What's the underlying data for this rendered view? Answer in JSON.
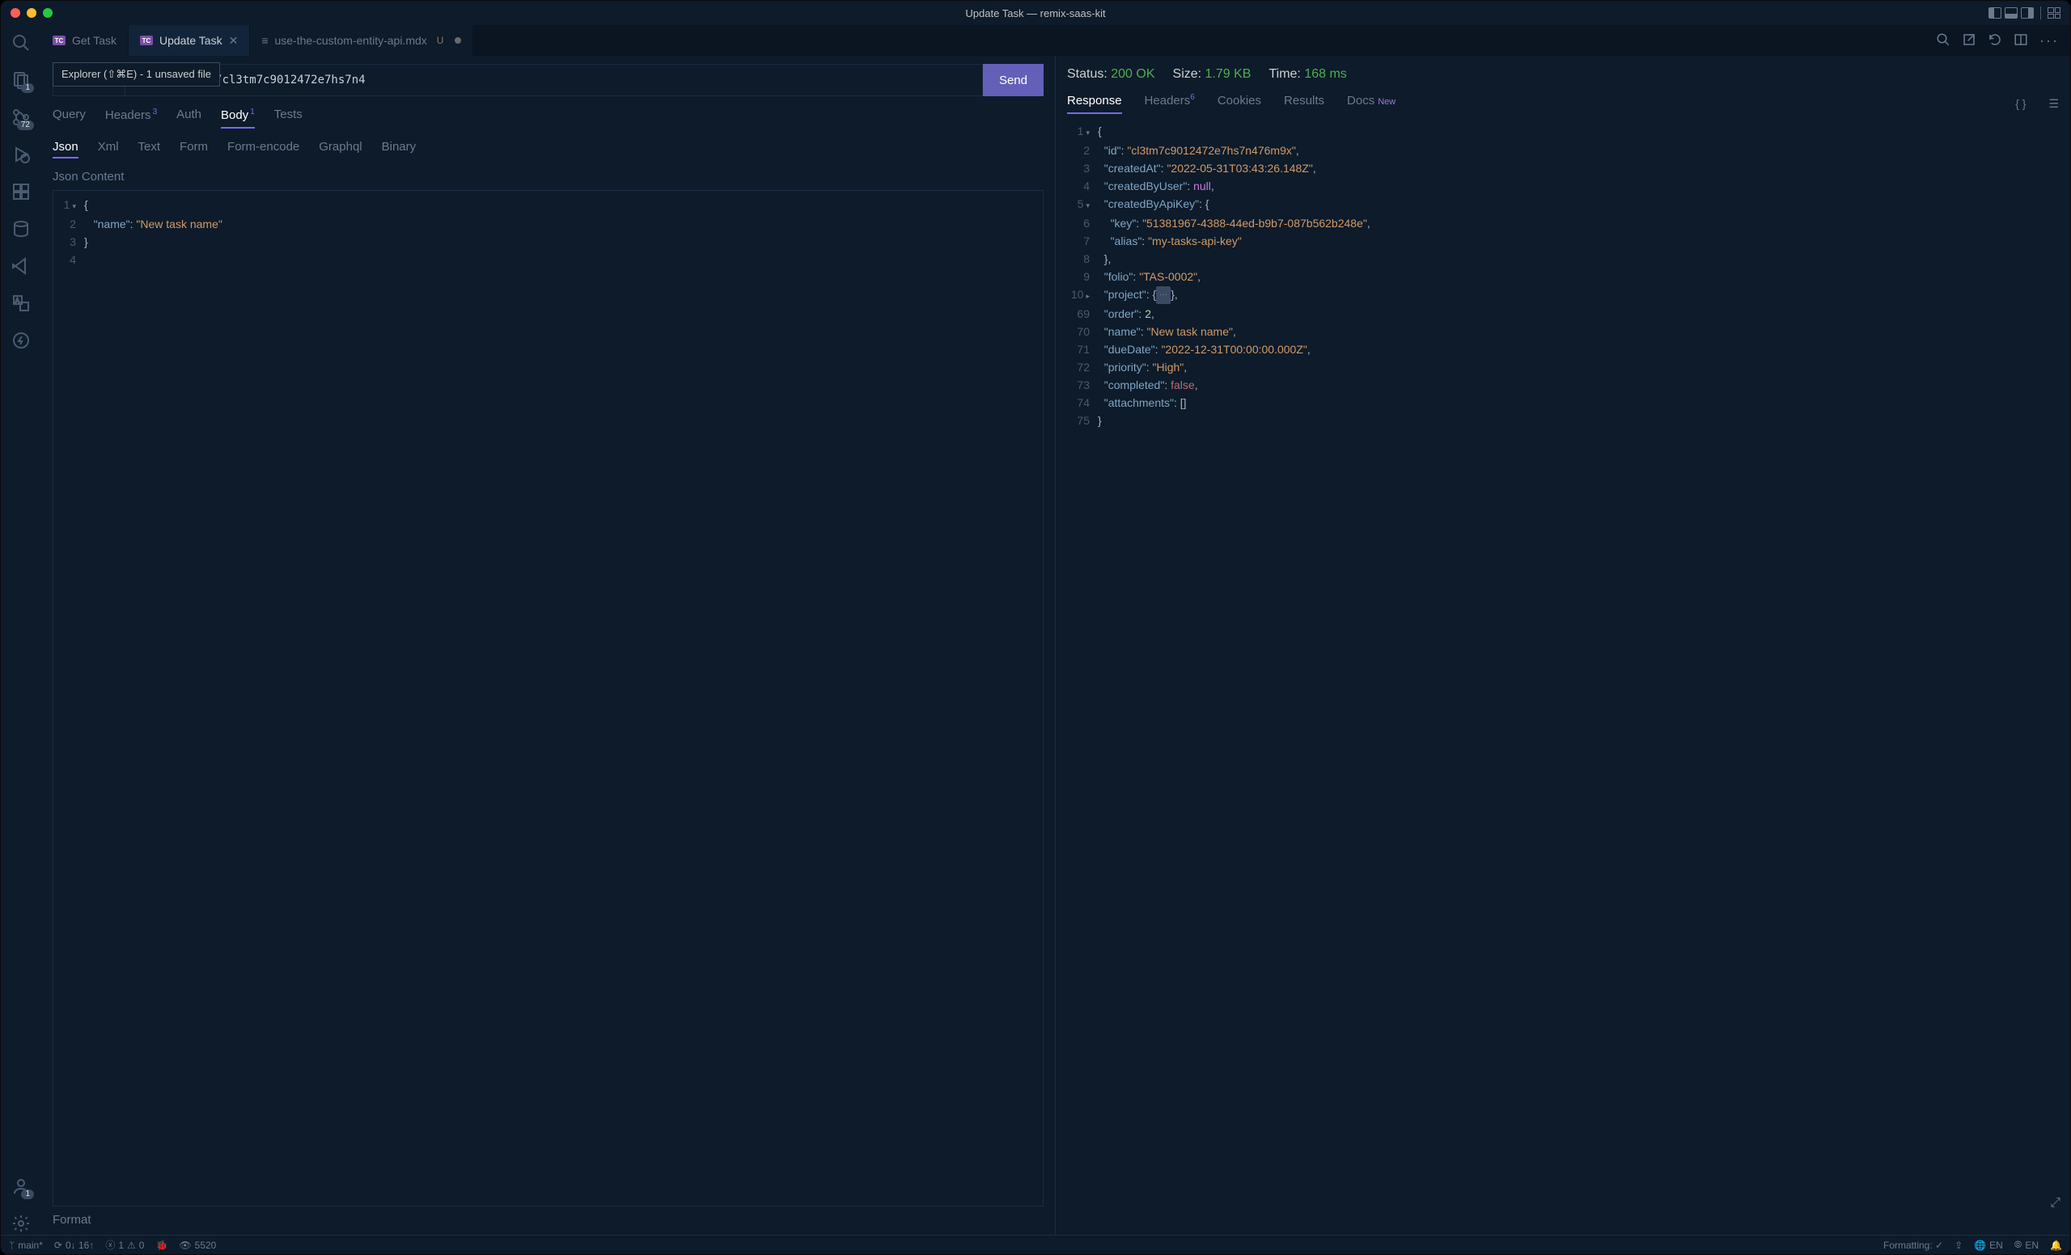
{
  "window_title": "Update Task — remix-saas-kit",
  "tabs": [
    {
      "icon": "TC",
      "label": "Get Task",
      "active": false,
      "closable": false
    },
    {
      "icon": "TC",
      "label": "Update Task",
      "active": true,
      "closable": true
    },
    {
      "icon": "list",
      "label": "use-the-custom-entity-api.mdx",
      "active": false,
      "badge": "U",
      "dot": true
    }
  ],
  "tooltip": "Explorer (⇧⌘E) - 1 unsaved file",
  "activity_badges": {
    "explorer": "1",
    "scm": "72",
    "account": "1"
  },
  "url_bar": {
    "url_visible": ")0/api/tasks/cl3tm7c9012472e7hs7n4",
    "send": "Send"
  },
  "request_tabs": [
    {
      "label": "Query"
    },
    {
      "label": "Headers",
      "badge": "3"
    },
    {
      "label": "Auth"
    },
    {
      "label": "Body",
      "badge": "1",
      "active": true
    },
    {
      "label": "Tests"
    }
  ],
  "body_type_tabs": [
    {
      "label": "Json",
      "active": true
    },
    {
      "label": "Xml"
    },
    {
      "label": "Text"
    },
    {
      "label": "Form"
    },
    {
      "label": "Form-encode"
    },
    {
      "label": "Graphql"
    },
    {
      "label": "Binary"
    }
  ],
  "json_content_label": "Json Content",
  "request_body_lines": [
    {
      "n": "1",
      "fold": true,
      "tokens": [
        [
          "punc",
          "{"
        ]
      ]
    },
    {
      "n": "2",
      "tokens": [
        [
          "",
          "   "
        ],
        [
          "key",
          "\"name\""
        ],
        [
          "punc",
          ": "
        ],
        [
          "str",
          "\"New task name\""
        ]
      ]
    },
    {
      "n": "3",
      "tokens": [
        [
          "punc",
          "}"
        ]
      ]
    },
    {
      "n": "4",
      "tokens": []
    }
  ],
  "format_label": "Format",
  "status": {
    "status_label": "Status: ",
    "status_val": "200 OK",
    "size_label": "Size: ",
    "size_val": "1.79 KB",
    "time_label": "Time: ",
    "time_val": "168 ms"
  },
  "response_tabs": [
    {
      "label": "Response",
      "active": true
    },
    {
      "label": "Headers",
      "badge": "6"
    },
    {
      "label": "Cookies"
    },
    {
      "label": "Results"
    },
    {
      "label": "Docs",
      "new": "New"
    }
  ],
  "response_lines": [
    {
      "n": "1",
      "fold": "down",
      "tokens": [
        [
          "punc",
          "{"
        ]
      ]
    },
    {
      "n": "2",
      "tokens": [
        [
          "",
          "  "
        ],
        [
          "key",
          "\"id\""
        ],
        [
          "punc",
          ": "
        ],
        [
          "str",
          "\"cl3tm7c9012472e7hs7n476m9x\""
        ],
        [
          "punc",
          ","
        ]
      ]
    },
    {
      "n": "3",
      "tokens": [
        [
          "",
          "  "
        ],
        [
          "key",
          "\"createdAt\""
        ],
        [
          "punc",
          ": "
        ],
        [
          "str",
          "\"2022-05-31T03:43:26.148Z\""
        ],
        [
          "punc",
          ","
        ]
      ]
    },
    {
      "n": "4",
      "tokens": [
        [
          "",
          "  "
        ],
        [
          "key",
          "\"createdByUser\""
        ],
        [
          "punc",
          ": "
        ],
        [
          "null",
          "null"
        ],
        [
          "punc",
          ","
        ]
      ]
    },
    {
      "n": "5",
      "fold": "down",
      "tokens": [
        [
          "",
          "  "
        ],
        [
          "key",
          "\"createdByApiKey\""
        ],
        [
          "punc",
          ": {"
        ]
      ]
    },
    {
      "n": "6",
      "tokens": [
        [
          "",
          "    "
        ],
        [
          "key",
          "\"key\""
        ],
        [
          "punc",
          ": "
        ],
        [
          "str",
          "\"51381967-4388-44ed-b9b7-087b562b248e\""
        ],
        [
          "punc",
          ","
        ]
      ]
    },
    {
      "n": "7",
      "tokens": [
        [
          "",
          "    "
        ],
        [
          "key",
          "\"alias\""
        ],
        [
          "punc",
          ": "
        ],
        [
          "str",
          "\"my-tasks-api-key\""
        ]
      ]
    },
    {
      "n": "8",
      "tokens": [
        [
          "",
          "  "
        ],
        [
          "punc",
          "},"
        ]
      ]
    },
    {
      "n": "9",
      "tokens": [
        [
          "",
          "  "
        ],
        [
          "key",
          "\"folio\""
        ],
        [
          "punc",
          ": "
        ],
        [
          "str",
          "\"TAS-0002\""
        ],
        [
          "punc",
          ","
        ]
      ]
    },
    {
      "n": "10",
      "fold": "right",
      "tokens": [
        [
          "",
          "  "
        ],
        [
          "key",
          "\"project\""
        ],
        [
          "punc",
          ": {"
        ],
        [
          "fold",
          "···"
        ],
        [
          "punc",
          "},"
        ]
      ]
    },
    {
      "n": "69",
      "tokens": [
        [
          "",
          "  "
        ],
        [
          "key",
          "\"order\""
        ],
        [
          "punc",
          ": "
        ],
        [
          "num",
          "2"
        ],
        [
          "punc",
          ","
        ]
      ]
    },
    {
      "n": "70",
      "tokens": [
        [
          "",
          "  "
        ],
        [
          "key",
          "\"name\""
        ],
        [
          "punc",
          ": "
        ],
        [
          "str",
          "\"New task name\""
        ],
        [
          "punc",
          ","
        ]
      ]
    },
    {
      "n": "71",
      "tokens": [
        [
          "",
          "  "
        ],
        [
          "key",
          "\"dueDate\""
        ],
        [
          "punc",
          ": "
        ],
        [
          "str",
          "\"2022-12-31T00:00:00.000Z\""
        ],
        [
          "punc",
          ","
        ]
      ]
    },
    {
      "n": "72",
      "tokens": [
        [
          "",
          "  "
        ],
        [
          "key",
          "\"priority\""
        ],
        [
          "punc",
          ": "
        ],
        [
          "str",
          "\"High\""
        ],
        [
          "punc",
          ","
        ]
      ]
    },
    {
      "n": "73",
      "tokens": [
        [
          "",
          "  "
        ],
        [
          "key",
          "\"completed\""
        ],
        [
          "punc",
          ": "
        ],
        [
          "false",
          "false"
        ],
        [
          "punc",
          ","
        ]
      ]
    },
    {
      "n": "74",
      "tokens": [
        [
          "",
          "  "
        ],
        [
          "key",
          "\"attachments\""
        ],
        [
          "punc",
          ": []"
        ]
      ]
    },
    {
      "n": "75",
      "tokens": [
        [
          "punc",
          "}"
        ]
      ]
    }
  ],
  "statusbar": {
    "branch": "main*",
    "sync": "0↓ 16↑",
    "errors": "1",
    "warnings": "0",
    "views": "5520",
    "formatting": "Formatting: ✓",
    "lang1": "EN",
    "lang2": "EN"
  }
}
